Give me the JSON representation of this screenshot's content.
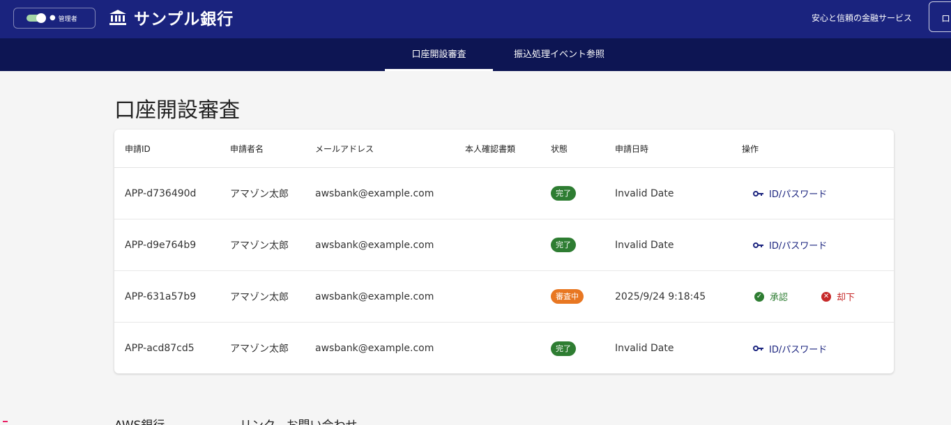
{
  "header": {
    "role_label": "管理者",
    "brand_name": "サンプル銀行",
    "tagline": "安心と信頼の金融サービス",
    "login_button_fragment": "ロ"
  },
  "nav": {
    "tabs": [
      {
        "label": "口座開設審査",
        "active": true
      },
      {
        "label": "振込処理イベント参照",
        "active": false
      }
    ]
  },
  "main": {
    "title": "口座開設審査",
    "table": {
      "columns": [
        "申請ID",
        "申請者名",
        "メールアドレス",
        "本人確認書類",
        "状態",
        "申請日時",
        "操作"
      ],
      "rows": [
        {
          "id": "APP-d736490d",
          "name": "アマゾン太郎",
          "email": "awsbank@example.com",
          "docs": "",
          "status": "完了",
          "date": "Invalid Date",
          "action": "ID/パスワード"
        },
        {
          "id": "APP-d9e764b9",
          "name": "アマゾン太郎",
          "email": "awsbank@example.com",
          "docs": "",
          "status": "完了",
          "date": "Invalid Date",
          "action": "ID/パスワード"
        },
        {
          "id": "APP-631a57b9",
          "name": "アマゾン太郎",
          "email": "awsbank@example.com",
          "docs": "",
          "status": "審査中",
          "date": "2025/9/24 9:18:45",
          "approve": "承認",
          "reject": "却下"
        },
        {
          "id": "APP-acd87cd5",
          "name": "アマゾン太郎",
          "email": "awsbank@example.com",
          "docs": "",
          "status": "完了",
          "date": "Invalid Date",
          "action": "ID/パスワード"
        }
      ]
    }
  },
  "footer": {
    "col1": "AWS銀行",
    "col2": "リンク、お問い合わせ"
  },
  "colors": {
    "header_bg": "#1a237e",
    "nav_bg": "#0d1553",
    "status_done": "#2e7d32",
    "status_review": "#e87722",
    "reject": "#c62828"
  }
}
